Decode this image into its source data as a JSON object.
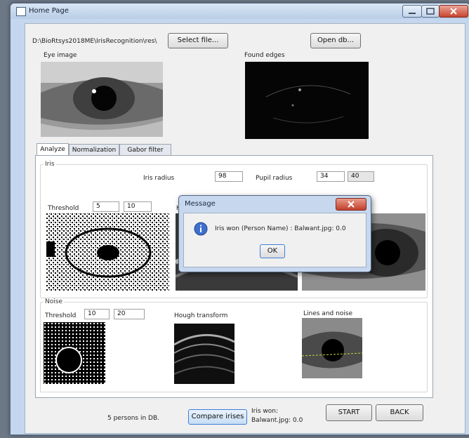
{
  "window": {
    "title": "Home Page"
  },
  "top": {
    "path_value": "D:\\BioRtsys2018ME\\IrisRecognition\\res\\",
    "select_file_label": "Select file...",
    "open_db_label": "Open db...",
    "eye_image_label": "Eye image",
    "found_edges_label": "Found edges"
  },
  "tabs": [
    "Analyze",
    "Normalization",
    "Gabor filter"
  ],
  "iris": {
    "group_label": "Iris",
    "iris_radius_label": "Iris radius",
    "iris_radius_value": "98",
    "pupil_radius_label": "Pupil radius",
    "pupil_radius_value": "34",
    "pupil_radius_value2": "40",
    "threshold_label": "Threshold",
    "threshold_min": "5",
    "threshold_max": "10",
    "hough_label_partial": "Ho"
  },
  "noise": {
    "group_label": "Noise",
    "threshold_label": "Threshold",
    "threshold_min": "10",
    "threshold_max": "20",
    "hough_label": "Hough transform",
    "lines_label": "Lines and noise"
  },
  "bottom": {
    "persons_text": "5 persons in DB.",
    "compare_label": "Compare irises",
    "result_line1": "Iris won:",
    "result_line2": "Balwant.jpg: 0.0",
    "start_label": "START",
    "back_label": "BACK"
  },
  "dialog": {
    "title": "Message",
    "message": "Iris won (Person Name) : Balwant.jpg: 0.0",
    "ok_label": "OK",
    "icon": "info-icon"
  },
  "colors": {
    "accent": "#3d7fd8",
    "close_red": "#c2402b"
  }
}
